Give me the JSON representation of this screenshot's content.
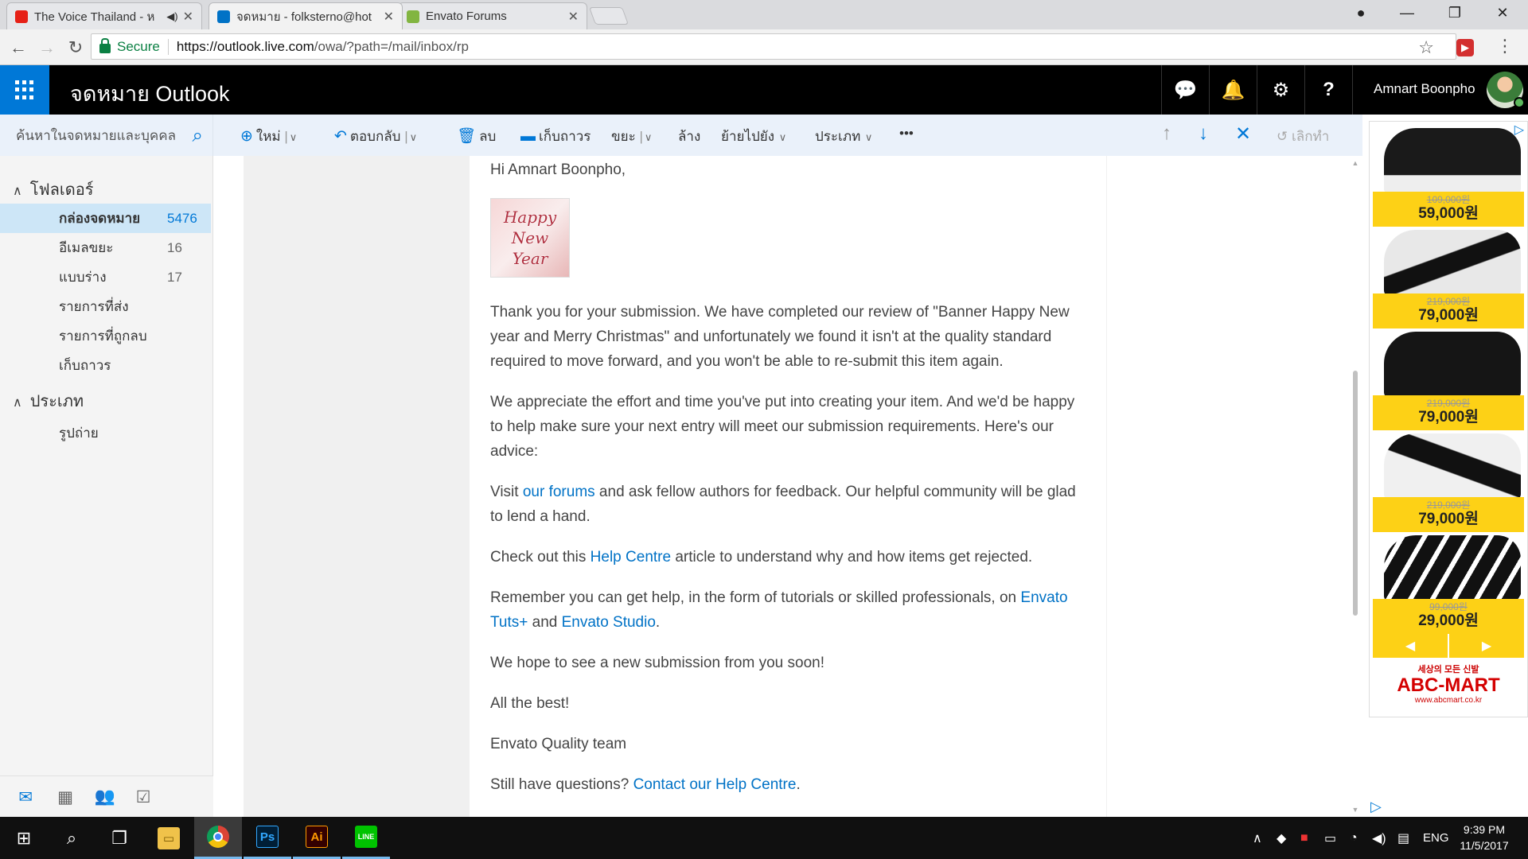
{
  "browser": {
    "tabs": [
      {
        "title": "The Voice Thailand - ห",
        "favicon_color": "#e62117",
        "audio": true
      },
      {
        "title": "จดหมาย - folksterno@hot",
        "favicon_color": "#0072c6"
      },
      {
        "title": "Envato Forums",
        "favicon_color": "#82b541"
      }
    ],
    "secure_label": "Secure",
    "url_host": "https://outlook.live.com",
    "url_path": "/owa/?path=/mail/inbox/rp"
  },
  "outlook": {
    "brand": "จดหมาย Outlook",
    "user_name": "Amnart Boonpho",
    "search_placeholder": "ค้นหาในจดหมายและบุคคล",
    "commands": {
      "new": "ใหม่",
      "reply": "ตอบกลับ",
      "delete": "ลบ",
      "archive": "เก็บถาวร",
      "junk": "ขยะ",
      "sweep": "ล้าง",
      "move": "ย้ายไปยัง",
      "categorize": "ประเภท",
      "more": "•••",
      "undo": "เลิกทำ"
    },
    "folders_heading": "โฟลเดอร์",
    "folders": [
      {
        "name": "กล่องจดหมาย",
        "count": "5476",
        "selected": true
      },
      {
        "name": "อีเมลขยะ",
        "count": "16"
      },
      {
        "name": "แบบร่าง",
        "count": "17"
      },
      {
        "name": "รายการที่ส่ง",
        "count": ""
      },
      {
        "name": "รายการที่ถูกลบ",
        "count": ""
      },
      {
        "name": "เก็บถาวร",
        "count": ""
      }
    ],
    "categories_heading": "ประเภท",
    "categories": [
      {
        "name": "รูปถ่าย"
      }
    ]
  },
  "email": {
    "greeting": "Hi Amnart Boonpho,",
    "image_text": [
      "Happy",
      "New",
      "Year"
    ],
    "p1": "Thank you for your submission. We have completed our review of \"Banner Happy New year and Merry Christmas\" and unfortunately we found it isn't at the quality standard required to move forward, and you won't be able to re-submit this item again.",
    "p2": "We appreciate the effort and time you've put into creating your item. And we'd be happy to help make sure your next entry will meet our submission requirements. Here's our advice:",
    "p3_a": "Visit ",
    "p3_link": "our forums",
    "p3_b": " and ask fellow authors for feedback. Our helpful community will be glad to lend a hand.",
    "p4_a": "Check out this ",
    "p4_link": "Help Centre",
    "p4_b": " article to understand why and how items get rejected.",
    "p5_a": "Remember you can get help, in the form of tutorials or skilled professionals, on ",
    "p5_link1": "Envato Tuts+",
    "p5_mid": " and ",
    "p5_link2": "Envato Studio",
    "p5_end": ".",
    "p6": "We hope to see a new submission from you soon!",
    "p7": "All the best!",
    "p8": "Envato Quality team",
    "p9_a": "Still have questions? ",
    "p9_link": "Contact our Help Centre",
    "p9_end": "."
  },
  "ad": {
    "items": [
      {
        "old_price": "109,000원",
        "price": "59,000원",
        "shoe_color": "#1a1a1a"
      },
      {
        "old_price": "219,000원",
        "price": "79,000원",
        "shoe_color": "#e8e8e8"
      },
      {
        "old_price": "219,000원",
        "price": "79,000원",
        "shoe_color": "#151515"
      },
      {
        "old_price": "219,000원",
        "price": "79,000원",
        "shoe_color": "#f0f0f0"
      },
      {
        "old_price": "99,000원",
        "price": "29,000원",
        "shoe_color": "#111111"
      }
    ],
    "prev": "◀",
    "next": "▶",
    "brand_tagline": "세상의 모든 신발",
    "brand": "ABC-MART",
    "site": "www.abcmart.co.kr",
    "price_band_color": "#fdd116"
  },
  "taskbar": {
    "lang": "ENG",
    "time": "9:39 PM",
    "date": "11/5/2017",
    "apps": [
      {
        "name": "Ps",
        "bg": "#001e36",
        "fg": "#31a8ff"
      },
      {
        "name": "Ai",
        "bg": "#330000",
        "fg": "#ff9a00"
      },
      {
        "name": "LINE",
        "bg": "#00c300",
        "fg": "#ffffff"
      }
    ]
  },
  "colors": {
    "accent": "#0078d7",
    "link": "#0072c6"
  }
}
